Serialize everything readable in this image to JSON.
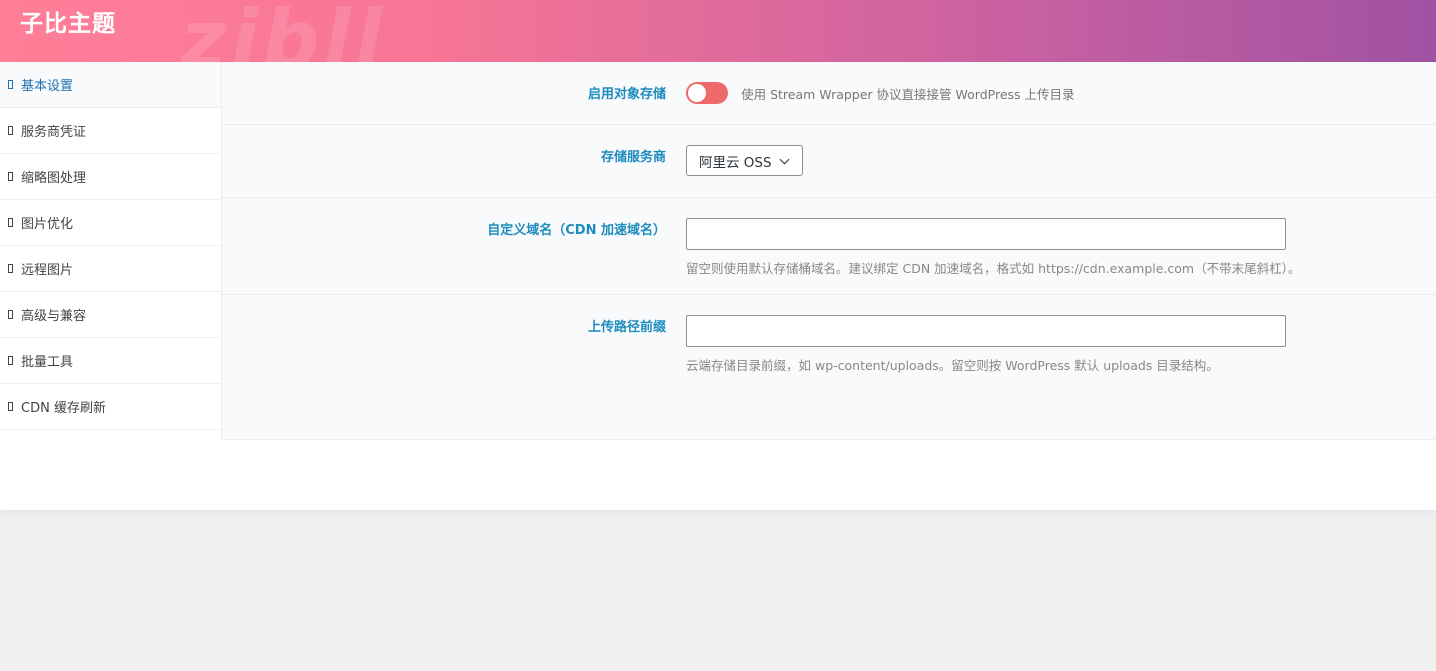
{
  "header": {
    "title": "子比主题",
    "watermark": "zibll"
  },
  "sidebar": {
    "items": [
      {
        "label": "基本设置",
        "active": true
      },
      {
        "label": "服务商凭证"
      },
      {
        "label": "缩略图处理"
      },
      {
        "label": "图片优化"
      },
      {
        "label": "远程图片"
      },
      {
        "label": "高级与兼容"
      },
      {
        "label": "批量工具"
      },
      {
        "label": "CDN 缓存刷新"
      }
    ]
  },
  "fields": {
    "enable_storage": {
      "label": "启用对象存储",
      "description": "使用 Stream Wrapper 协议直接接管 WordPress 上传目录",
      "enabled": false
    },
    "provider": {
      "label": "存储服务商",
      "selected": "阿里云 OSS"
    },
    "custom_domain": {
      "label": "自定义域名（CDN 加速域名）",
      "value": "",
      "help": "留空则使用默认存储桶域名。建议绑定 CDN 加速域名，格式如 https://cdn.example.com（不带末尾斜杠）。"
    },
    "upload_prefix": {
      "label": "上传路径前缀",
      "value": "",
      "help": "云端存储目录前缀，如 wp-content/uploads。留空则按 WordPress 默认 uploads 目录结构。"
    }
  },
  "colors": {
    "accent": "#1e8cbe",
    "toggle_off": "#ee6a6a",
    "header_gradient_start": "#ff7f98",
    "header_gradient_end": "#a052a2"
  }
}
